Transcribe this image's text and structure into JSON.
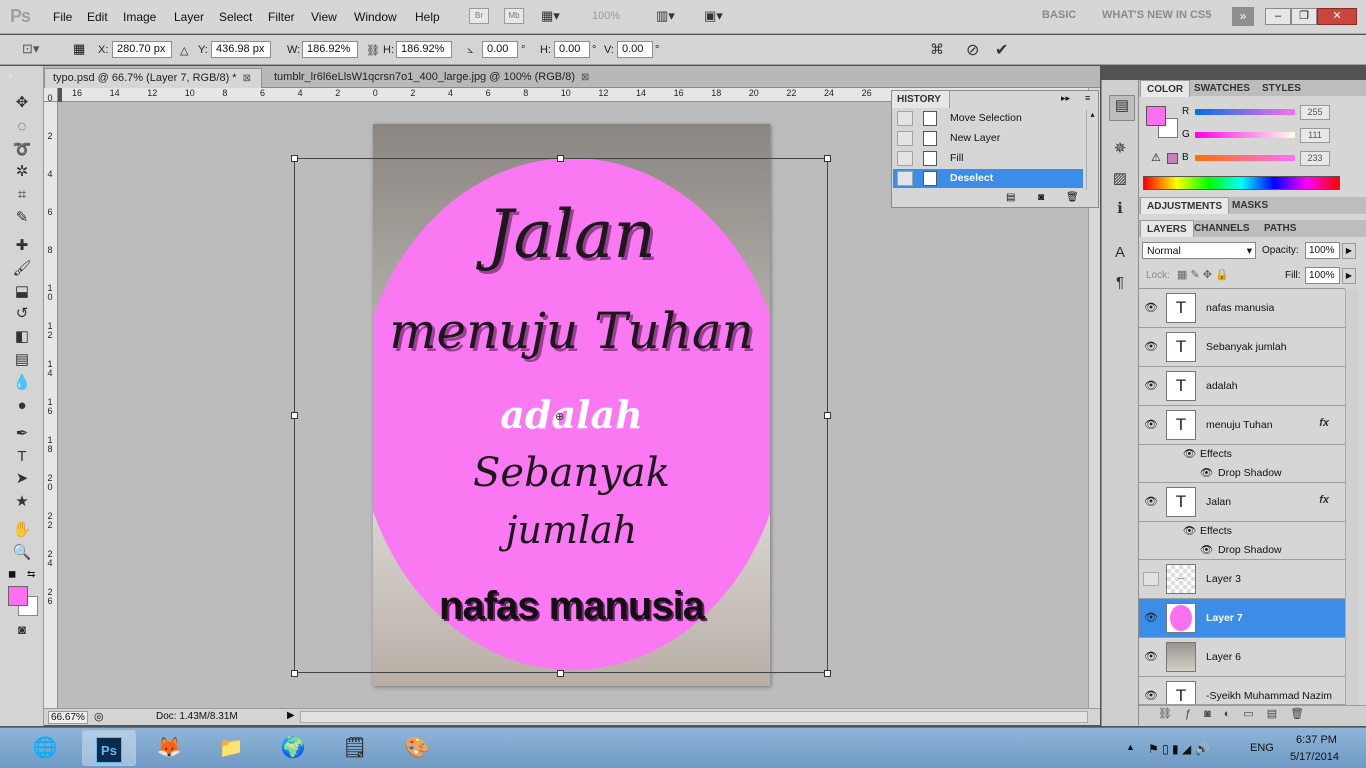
{
  "app": {
    "logo": "Ps"
  },
  "menu": [
    "File",
    "Edit",
    "Image",
    "Layer",
    "Select",
    "Filter",
    "View",
    "Window",
    "Help"
  ],
  "menubar_icons": {
    "bridge": "Br",
    "mini": "Mb",
    "zoom": "100%"
  },
  "workspaces": {
    "basic": "BASIC",
    "whats_new": "WHAT'S NEW IN CS5"
  },
  "options": {
    "x_label": "X:",
    "x_value": "280.70 px",
    "y_label": "Y:",
    "y_value": "436.98 px",
    "w_label": "W:",
    "w_value": "186.92%",
    "h_label": "H:",
    "h_value": "186.92%",
    "angle_value": "0.00",
    "angle_unit": "°",
    "hskew_label": "H:",
    "hskew_value": "0.00",
    "hskew_unit": "°",
    "vskew_label": "V:",
    "vskew_value": "0.00",
    "vskew_unit": "°"
  },
  "tabs": [
    {
      "label": "typo.psd @ 66.7% (Layer 7, RGB/8) *",
      "active": true
    },
    {
      "label": "tumblr_lr6l6eLlsW1qcrsn7o1_400_large.jpg @ 100% (RGB/8)",
      "active": false
    }
  ],
  "ruler": {
    "h": [
      "16",
      "14",
      "12",
      "10",
      "8",
      "6",
      "4",
      "2",
      "0",
      "2",
      "4",
      "6",
      "8",
      "10",
      "12",
      "14",
      "16",
      "18",
      "20",
      "22",
      "24",
      "26"
    ],
    "v": [
      "0",
      "2",
      "4",
      "6",
      "8",
      "1\n0",
      "1\n2",
      "1\n4",
      "1\n6",
      "1\n8",
      "2\n0",
      "2\n2",
      "2\n4",
      "2\n6"
    ]
  },
  "canvas_text": {
    "line1": "Jalan",
    "line2": "menuju Tuhan",
    "line3": "adalah",
    "line4": "Sebanyak",
    "line5": "jumlah",
    "line6": "nafas manusia"
  },
  "status": {
    "zoom": "66.67%",
    "doc": "Doc: 1.43M/8.31M"
  },
  "history": {
    "title": "HISTORY",
    "items": [
      "Move Selection",
      "New Layer",
      "Fill",
      "Deselect"
    ],
    "selected_index": 3
  },
  "color_panel": {
    "tabs": [
      "COLOR",
      "SWATCHES",
      "STYLES"
    ],
    "r_label": "R",
    "r": "255",
    "g_label": "G",
    "g": "111",
    "b_label": "B",
    "b": "233",
    "foreground": "#fb6ff0",
    "background": "#ffffff"
  },
  "adjustments_tabs": [
    "ADJUSTMENTS",
    "MASKS"
  ],
  "layers_panel": {
    "tabs": [
      "LAYERS",
      "CHANNELS",
      "PATHS"
    ],
    "blend_mode": "Normal",
    "opacity_label": "Opacity:",
    "opacity": "100%",
    "lock_label": "Lock:",
    "fill_label": "Fill:",
    "fill": "100%",
    "layers": [
      {
        "name": "nafas manusia",
        "type": "T",
        "fx": false
      },
      {
        "name": "Sebanyak  jumlah",
        "type": "T",
        "fx": false
      },
      {
        "name": "adalah",
        "type": "T",
        "fx": false
      },
      {
        "name": "menuju Tuhan",
        "type": "T",
        "fx": true
      },
      {
        "name": "Jalan",
        "type": "T",
        "fx": true
      },
      {
        "name": "Layer 3",
        "type": "raster",
        "fx": false
      },
      {
        "name": "Layer 7",
        "type": "raster",
        "fx": false,
        "selected": true
      },
      {
        "name": "Layer 6",
        "type": "photo",
        "fx": false
      },
      {
        "name": "-Syeikh Muhammad Nazim",
        "type": "T",
        "fx": false
      }
    ],
    "effects_label": "Effects",
    "drop_shadow_label": "Drop Shadow",
    "fx_label": "fx"
  },
  "tray": {
    "lang": "ENG",
    "time": "6:37 PM",
    "date": "5/17/2014"
  }
}
